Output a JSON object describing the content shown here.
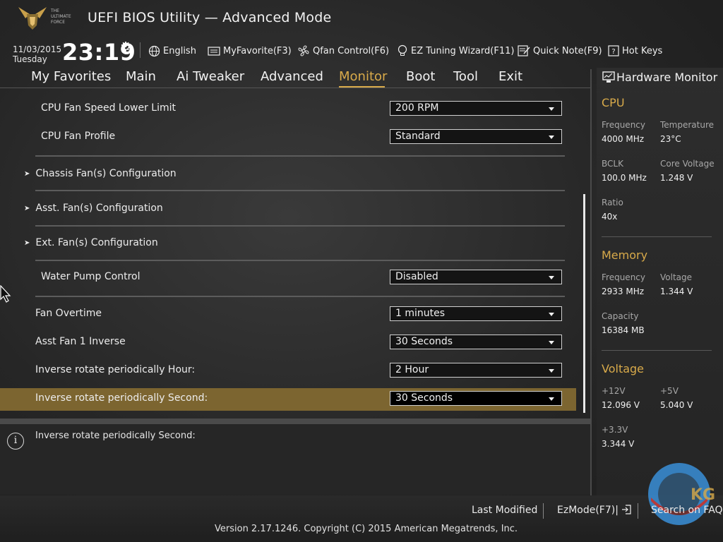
{
  "header": {
    "title": "UEFI BIOS Utility — Advanced Mode",
    "logo_text": [
      "THE",
      "ULTIMATE",
      "FORCE"
    ],
    "date": "11/03/2015",
    "weekday": "Tuesday",
    "time": "23:19",
    "toolbar": {
      "language": "English",
      "myfavorite": "MyFavorite(F3)",
      "qfan": "Qfan Control(F6)",
      "ez_tuning": "EZ Tuning Wizard(F11)",
      "quick_note": "Quick Note(F9)",
      "hot_keys": "Hot Keys"
    }
  },
  "nav": {
    "tabs": [
      "My Favorites",
      "Main",
      "Ai Tweaker",
      "Advanced",
      "Monitor",
      "Boot",
      "Tool",
      "Exit"
    ],
    "active": "Monitor"
  },
  "settings": {
    "cpu_fan_lower_limit": {
      "label": "CPU Fan Speed Lower Limit",
      "value": "200 RPM"
    },
    "cpu_fan_profile": {
      "label": "CPU Fan Profile",
      "value": "Standard"
    },
    "submenus": [
      "Chassis Fan(s) Configuration",
      "Asst. Fan(s) Configuration",
      "Ext. Fan(s) Configuration"
    ],
    "water_pump": {
      "label": "Water Pump Control",
      "value": "Disabled"
    },
    "fan_overtime": {
      "label": "Fan Overtime",
      "value": "1 minutes"
    },
    "asst_fan_inverse": {
      "label": "Asst Fan 1 Inverse",
      "value": "30 Seconds"
    },
    "inverse_hour": {
      "label": "Inverse rotate periodically Hour:",
      "value": "2 Hour"
    },
    "inverse_second": {
      "label": "Inverse rotate periodically Second:",
      "value": "30 Seconds"
    }
  },
  "help": {
    "text": "Inverse rotate periodically Second:"
  },
  "hardware_monitor": {
    "title": "Hardware Monitor",
    "cpu": {
      "heading": "CPU",
      "frequency_label": "Frequency",
      "frequency": "4000 MHz",
      "temperature_label": "Temperature",
      "temperature": "23°C",
      "bclk_label": "BCLK",
      "bclk": "100.0 MHz",
      "core_voltage_label": "Core Voltage",
      "core_voltage": "1.248 V",
      "ratio_label": "Ratio",
      "ratio": "40x"
    },
    "memory": {
      "heading": "Memory",
      "frequency_label": "Frequency",
      "frequency": "2933 MHz",
      "voltage_label": "Voltage",
      "voltage": "1.344 V",
      "capacity_label": "Capacity",
      "capacity": "16384 MB"
    },
    "voltage": {
      "heading": "Voltage",
      "v12_label": "+12V",
      "v12": "12.096 V",
      "v5_label": "+5V",
      "v5": "5.040 V",
      "v33_label": "+3.3V",
      "v33": "3.344 V"
    }
  },
  "footer": {
    "last_modified": "Last Modified",
    "ezmode": "EzMode(F7)|",
    "search_faq": "Search on FAQ",
    "version": "Version 2.17.1246. Copyright (C) 2015 American Megatrends, Inc.",
    "watermark": "KG"
  },
  "colors": {
    "accent": "#d8aa4a",
    "highlight_row": "#7c6530"
  },
  "icons": [
    "logo",
    "gear-icon",
    "globe-icon",
    "myfavorite-icon",
    "fan-icon",
    "bulb-icon",
    "note-icon",
    "help-icon",
    "monitor-icon",
    "info-icon",
    "exit-icon",
    "mouse-cursor"
  ]
}
